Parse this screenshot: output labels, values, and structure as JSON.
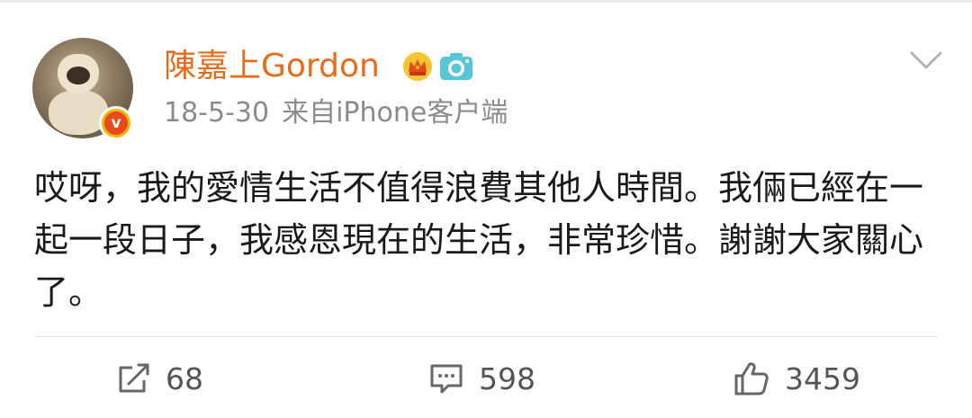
{
  "post": {
    "username": "陳嘉上Gordon",
    "timestamp": "18-5-30",
    "source": "来自iPhone客户端",
    "content": "哎呀，我的愛情生活不值得浪費其他人時間。我倆已經在一起一段日子，我感恩現在的生活，非常珍惜。謝謝大家關心了。",
    "badges": {
      "verified": "v",
      "crown_icon": "crown-icon",
      "camera_icon": "camera-icon"
    }
  },
  "actions": {
    "share_count": "68",
    "comment_count": "598",
    "like_count": "3459"
  },
  "colors": {
    "username": "#e86b17",
    "meta": "#8b8b8b",
    "text": "#1a1a1a",
    "verified_badge": "#e84a1b",
    "badge_ring": "#f2b705"
  }
}
